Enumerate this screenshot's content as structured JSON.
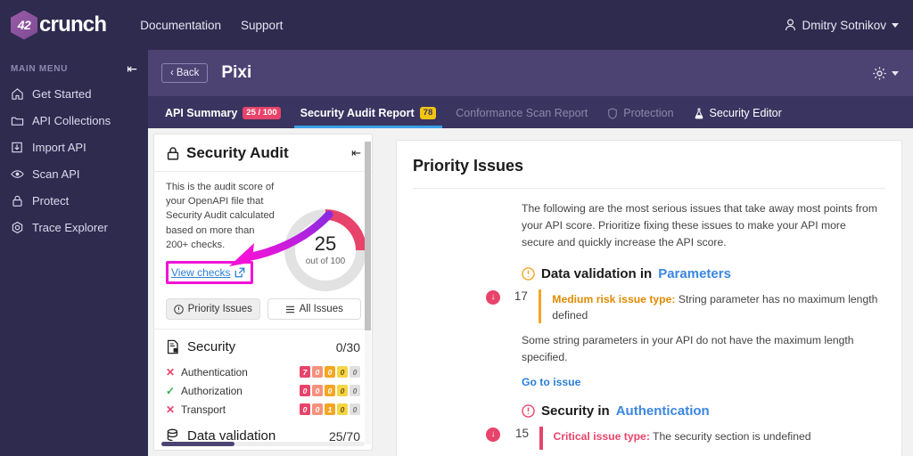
{
  "topbar": {
    "logo_text": "crunch",
    "logo_mark": "42",
    "nav": [
      {
        "label": "Documentation"
      },
      {
        "label": "Support"
      }
    ],
    "user": {
      "name": "Dmitry Sotnikov",
      "icon": "person-icon",
      "caret": "chevron-down-icon"
    }
  },
  "sidebar": {
    "section_label": "MAIN MENU",
    "collapse_icon": "collapse-panel-icon",
    "items": [
      {
        "label": "Get Started",
        "icon": "home-icon"
      },
      {
        "label": "API Collections",
        "icon": "folder-icon"
      },
      {
        "label": "Import API",
        "icon": "import-icon"
      },
      {
        "label": "Scan API",
        "icon": "eye-icon"
      },
      {
        "label": "Protect",
        "icon": "lock-icon"
      },
      {
        "label": "Trace Explorer",
        "icon": "hexagon-gear-icon"
      }
    ]
  },
  "pagehead": {
    "back_label": "Back",
    "title": "Pixi",
    "gear_icon": "gear-icon",
    "gear_caret": "chevron-down-icon"
  },
  "tabs": [
    {
      "label": "API Summary",
      "badge": "25 / 100",
      "badge_style": "red",
      "state": "inactive"
    },
    {
      "label": "Security Audit Report",
      "badge": "78",
      "badge_style": "yellow",
      "state": "active"
    },
    {
      "label": "Conformance Scan Report",
      "badge": "",
      "state": "disabled"
    },
    {
      "label": "Protection",
      "badge": "",
      "state": "disabled",
      "icon": "shield-icon"
    },
    {
      "label": "Security Editor",
      "badge": "",
      "state": "inactive",
      "icon": "flask-icon"
    }
  ],
  "audit": {
    "title": "Security Audit",
    "lock_icon": "lock-icon",
    "collapse_icon": "collapse-panel-icon",
    "description": "This is the audit score of your OpenAPI file that Security Audit calculated based on more than 200+ checks.",
    "view_checks_label": "View checks",
    "view_checks_icon": "external-link-icon",
    "score": "25",
    "score_sub": "out of 100",
    "score_percent": 25,
    "score_color": "#e8436a",
    "toggles": [
      {
        "label": "Priority Issues",
        "icon": "exclamation-circle-icon",
        "active": true
      },
      {
        "label": "All Issues",
        "icon": "list-icon",
        "active": false
      }
    ],
    "categories": [
      {
        "name": "Security",
        "icon": "document-lock-icon",
        "score": "0/30",
        "rows": [
          {
            "label": "Authentication",
            "status": "fail",
            "counts": [
              "7",
              "0",
              "0",
              "0",
              "0"
            ]
          },
          {
            "label": "Authorization",
            "status": "pass",
            "counts": [
              "0",
              "0",
              "0",
              "0",
              "0"
            ]
          },
          {
            "label": "Transport",
            "status": "fail",
            "counts": [
              "0",
              "0",
              "1",
              "0",
              "0"
            ]
          }
        ]
      },
      {
        "name": "Data validation",
        "icon": "database-icon",
        "score": "25/70",
        "rows": []
      }
    ]
  },
  "priority": {
    "title": "Priority Issues",
    "intro": "The following are the most serious issues that take away most points from your API score. Prioritize fixing these issues to make your API more secure and quickly increase the API score.",
    "groups": [
      {
        "icon": "warning-circle-icon",
        "icon_color": "#f5a623",
        "prefix": "Data validation in ",
        "link": "Parameters",
        "points": "17",
        "bar_color": "orange",
        "risk_label": "Medium risk issue type:",
        "risk_style": "orange",
        "issue_text": " String parameter has no maximum length defined",
        "description": "Some string parameters in your API do not have the maximum length specified.",
        "action_label": "Go to issue"
      },
      {
        "icon": "warning-circle-icon",
        "icon_color": "#e8436a",
        "prefix": "Security in ",
        "link": "Authentication",
        "points": "15",
        "bar_color": "red",
        "risk_label": "Critical issue type:",
        "risk_style": "red",
        "issue_text": " The security section is undefined",
        "description": "",
        "action_label": ""
      }
    ]
  }
}
